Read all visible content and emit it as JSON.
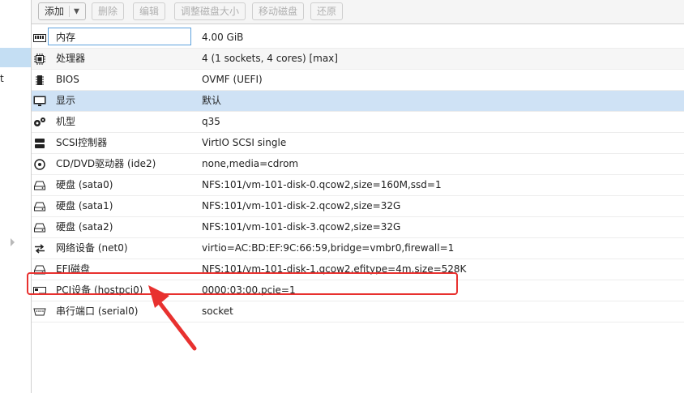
{
  "toolbar": {
    "add_label": "添加",
    "delete_label": "删除",
    "edit_label": "编辑",
    "resize_label": "调整磁盘大小",
    "move_label": "移动磁盘",
    "revert_label": "还原"
  },
  "left_panel": {
    "partial_text": "t"
  },
  "hardware_rows": [
    {
      "icon": "memory-icon",
      "label": "内存",
      "value": "4.00 GiB"
    },
    {
      "icon": "cpu-icon",
      "label": "处理器",
      "value": "4 (1 sockets, 4 cores) [max]"
    },
    {
      "icon": "bios-chip-icon",
      "label": "BIOS",
      "value": "OVMF (UEFI)"
    },
    {
      "icon": "monitor-icon",
      "label": "显示",
      "value": "默认"
    },
    {
      "icon": "gears-icon",
      "label": "机型",
      "value": "q35"
    },
    {
      "icon": "storage-controller-icon",
      "label": "SCSI控制器",
      "value": "VirtIO SCSI single"
    },
    {
      "icon": "cdrom-icon",
      "label": "CD/DVD驱动器 (ide2)",
      "value": "none,media=cdrom"
    },
    {
      "icon": "hard-disk-icon",
      "label": "硬盘 (sata0)",
      "value": "NFS:101/vm-101-disk-0.qcow2,size=160M,ssd=1"
    },
    {
      "icon": "hard-disk-icon",
      "label": "硬盘 (sata1)",
      "value": "NFS:101/vm-101-disk-2.qcow2,size=32G"
    },
    {
      "icon": "hard-disk-icon",
      "label": "硬盘 (sata2)",
      "value": "NFS:101/vm-101-disk-3.qcow2,size=32G"
    },
    {
      "icon": "network-icon",
      "label": "网络设备 (net0)",
      "value": "virtio=AC:BD:EF:9C:66:59,bridge=vmbr0,firewall=1"
    },
    {
      "icon": "hard-disk-icon",
      "label": "EFI磁盘",
      "value": "NFS:101/vm-101-disk-1.qcow2,efitype=4m,size=528K"
    },
    {
      "icon": "pci-card-icon",
      "label": "PCI设备 (hostpci0)",
      "value": "0000:03:00,pcie=1"
    },
    {
      "icon": "serial-port-icon",
      "label": "串行端口 (serial0)",
      "value": "socket"
    }
  ],
  "colors": {
    "selection": "#cfe2f5",
    "annotation_red": "#e8312f",
    "focus_border": "#5fa2dd"
  }
}
